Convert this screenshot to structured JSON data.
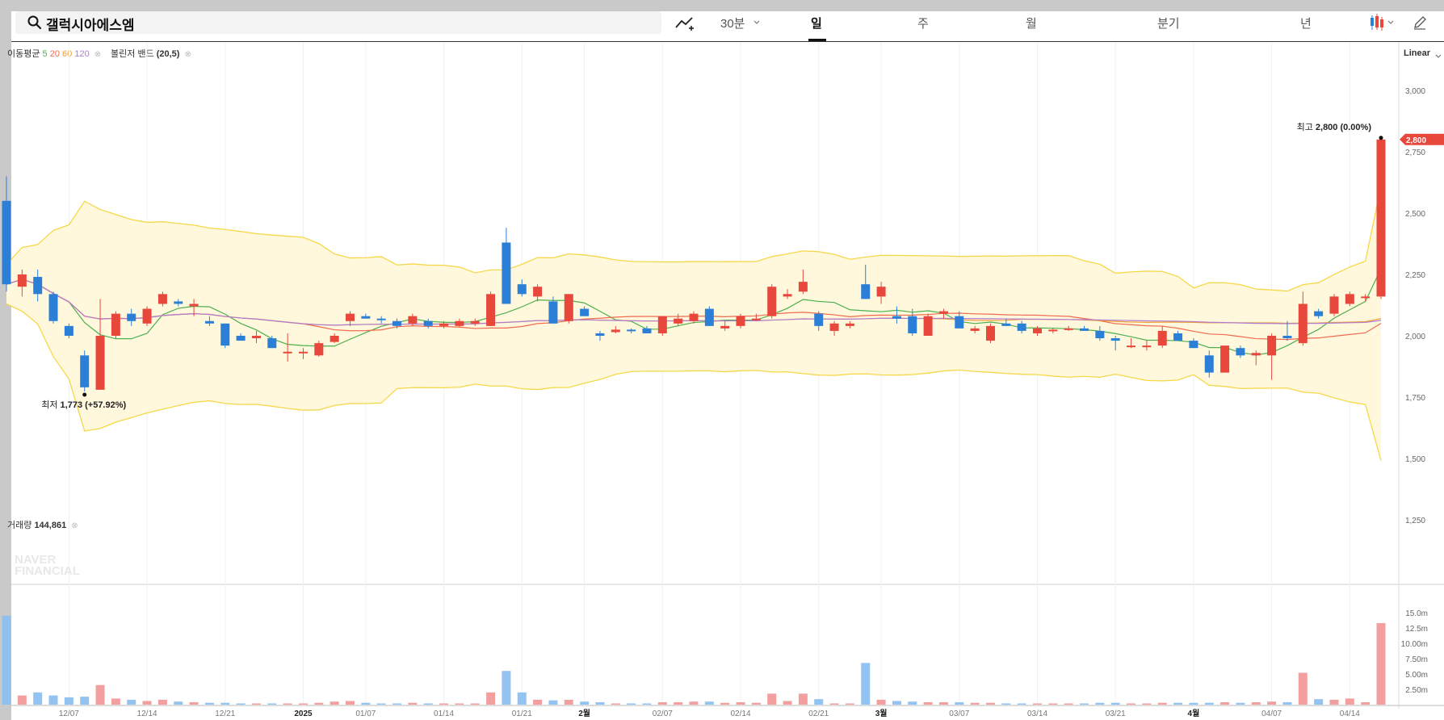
{
  "search": {
    "query": "갤럭시아에스엠"
  },
  "toolbar": {
    "interval": "30분",
    "periods": [
      "일",
      "주",
      "월",
      "분기",
      "년"
    ],
    "active_period": "일"
  },
  "indicators": {
    "ma_label": "이동평균",
    "ma_periods": [
      "5",
      "20",
      "60",
      "120"
    ],
    "ma_colors": [
      "#4caf50",
      "#f06b4f",
      "#f0a030",
      "#b07cd6"
    ],
    "bb_label": "볼린저 밴드",
    "bb_params": "(20,5)"
  },
  "scale_mode": "Linear",
  "volume_label": "거래량",
  "volume_value": "144,861",
  "watermark": [
    "NAVER",
    "FINANCIAL"
  ],
  "colors": {
    "up": "#e8473c",
    "down": "#2b7fd6",
    "band_line": "#f5d84a",
    "band_fill": "#fff8dc"
  },
  "chart_data": {
    "type": "candlestick",
    "price_ticks": [
      "3,000",
      "2,750",
      "2,500",
      "2,250",
      "2,000",
      "1,750",
      "1,500",
      "1,250"
    ],
    "price_tick_values": [
      3000,
      2750,
      2500,
      2250,
      2000,
      1750,
      1500,
      1250
    ],
    "volume_ticks": [
      "15.0m",
      "12.5m",
      "10.00m",
      "7.50m",
      "5.00m",
      "2.50m"
    ],
    "volume_tick_values": [
      15,
      12.5,
      10,
      7.5,
      5,
      2.5
    ],
    "x_ticks": [
      "12/07",
      "12/14",
      "12/21",
      "2025",
      "01/07",
      "01/14",
      "01/21",
      "2월",
      "02/07",
      "02/14",
      "02/21",
      "3월",
      "03/07",
      "03/14",
      "03/21",
      "4월",
      "04/07",
      "04/14"
    ],
    "x_tick_bold": [
      false,
      false,
      false,
      true,
      false,
      false,
      false,
      true,
      false,
      false,
      false,
      true,
      false,
      false,
      false,
      true,
      false,
      false
    ],
    "last_price_label": "2,800",
    "high": {
      "label": "최고",
      "value": "2,800",
      "change": "(0.00%)",
      "price": 2800
    },
    "low": {
      "label": "최저",
      "value": "1,773",
      "change": "(+57.92%)",
      "price": 1773
    },
    "candles": [
      {
        "o": 2550,
        "h": 2650,
        "l": 2180,
        "c": 2210,
        "v": 14.5
      },
      {
        "o": 2200,
        "h": 2270,
        "l": 2160,
        "c": 2250,
        "v": 1.5
      },
      {
        "o": 2240,
        "h": 2270,
        "l": 2140,
        "c": 2170,
        "v": 2.0
      },
      {
        "o": 2170,
        "h": 2180,
        "l": 2050,
        "c": 2060,
        "v": 1.5
      },
      {
        "o": 2040,
        "h": 2050,
        "l": 1990,
        "c": 2000,
        "v": 1.2
      },
      {
        "o": 1920,
        "h": 1940,
        "l": 1773,
        "c": 1790,
        "v": 1.3
      },
      {
        "o": 1780,
        "h": 2150,
        "l": 1780,
        "c": 2000,
        "v": 3.2
      },
      {
        "o": 2000,
        "h": 2100,
        "l": 1990,
        "c": 2090,
        "v": 1.0
      },
      {
        "o": 2090,
        "h": 2110,
        "l": 2040,
        "c": 2060,
        "v": 0.8
      },
      {
        "o": 2050,
        "h": 2120,
        "l": 2040,
        "c": 2110,
        "v": 0.6
      },
      {
        "o": 2130,
        "h": 2180,
        "l": 2120,
        "c": 2170,
        "v": 0.8
      },
      {
        "o": 2140,
        "h": 2150,
        "l": 2120,
        "c": 2130,
        "v": 0.5
      },
      {
        "o": 2120,
        "h": 2150,
        "l": 2080,
        "c": 2130,
        "v": 0.4
      },
      {
        "o": 2060,
        "h": 2080,
        "l": 2040,
        "c": 2050,
        "v": 0.3
      },
      {
        "o": 2050,
        "h": 2050,
        "l": 1950,
        "c": 1960,
        "v": 0.3
      },
      {
        "o": 2000,
        "h": 2010,
        "l": 1990,
        "c": 1980,
        "v": 0.2
      },
      {
        "o": 1990,
        "h": 2020,
        "l": 1970,
        "c": 2000,
        "v": 0.2
      },
      {
        "o": 1990,
        "h": 2000,
        "l": 1950,
        "c": 1950,
        "v": 0.2
      },
      {
        "o": 1935,
        "h": 2010,
        "l": 1895,
        "c": 1935,
        "v": 0.2
      },
      {
        "o": 1930,
        "h": 1950,
        "l": 1905,
        "c": 1935,
        "v": 0.2
      },
      {
        "o": 1920,
        "h": 1980,
        "l": 1915,
        "c": 1970,
        "v": 0.3
      },
      {
        "o": 1975,
        "h": 2010,
        "l": 1970,
        "c": 2000,
        "v": 0.5
      },
      {
        "o": 2060,
        "h": 2100,
        "l": 2040,
        "c": 2090,
        "v": 0.6
      },
      {
        "o": 2080,
        "h": 2090,
        "l": 2070,
        "c": 2070,
        "v": 0.3
      },
      {
        "o": 2070,
        "h": 2080,
        "l": 2050,
        "c": 2065,
        "v": 0.2
      },
      {
        "o": 2060,
        "h": 2070,
        "l": 2030,
        "c": 2040,
        "v": 0.2
      },
      {
        "o": 2050,
        "h": 2090,
        "l": 2040,
        "c": 2080,
        "v": 0.3
      },
      {
        "o": 2060,
        "h": 2070,
        "l": 2030,
        "c": 2040,
        "v": 0.2
      },
      {
        "o": 2040,
        "h": 2060,
        "l": 2030,
        "c": 2050,
        "v": 0.2
      },
      {
        "o": 2040,
        "h": 2070,
        "l": 2035,
        "c": 2060,
        "v": 0.2
      },
      {
        "o": 2050,
        "h": 2070,
        "l": 2040,
        "c": 2060,
        "v": 0.2
      },
      {
        "o": 2040,
        "h": 2180,
        "l": 2040,
        "c": 2170,
        "v": 2.0
      },
      {
        "o": 2380,
        "h": 2440,
        "l": 2130,
        "c": 2130,
        "v": 5.5
      },
      {
        "o": 2210,
        "h": 2230,
        "l": 2160,
        "c": 2170,
        "v": 2.0
      },
      {
        "o": 2160,
        "h": 2210,
        "l": 2140,
        "c": 2200,
        "v": 0.8
      },
      {
        "o": 2140,
        "h": 2160,
        "l": 2050,
        "c": 2050,
        "v": 0.7
      },
      {
        "o": 2060,
        "h": 2170,
        "l": 2050,
        "c": 2170,
        "v": 0.8
      },
      {
        "o": 2110,
        "h": 2120,
        "l": 2080,
        "c": 2080,
        "v": 0.5
      },
      {
        "o": 2010,
        "h": 2020,
        "l": 1980,
        "c": 2000,
        "v": 0.4
      },
      {
        "o": 2015,
        "h": 2040,
        "l": 2010,
        "c": 2025,
        "v": 0.2
      },
      {
        "o": 2025,
        "h": 2030,
        "l": 2010,
        "c": 2020,
        "v": 0.2
      },
      {
        "o": 2030,
        "h": 2040,
        "l": 2010,
        "c": 2010,
        "v": 0.2
      },
      {
        "o": 2010,
        "h": 2080,
        "l": 2000,
        "c": 2080,
        "v": 0.4
      },
      {
        "o": 2050,
        "h": 2090,
        "l": 2040,
        "c": 2070,
        "v": 0.4
      },
      {
        "o": 2060,
        "h": 2100,
        "l": 2050,
        "c": 2090,
        "v": 0.5
      },
      {
        "o": 2110,
        "h": 2120,
        "l": 2040,
        "c": 2040,
        "v": 0.5
      },
      {
        "o": 2030,
        "h": 2060,
        "l": 2020,
        "c": 2040,
        "v": 0.3
      },
      {
        "o": 2040,
        "h": 2090,
        "l": 2030,
        "c": 2080,
        "v": 0.4
      },
      {
        "o": 2070,
        "h": 2090,
        "l": 2060,
        "c": 2070,
        "v": 0.3
      },
      {
        "o": 2080,
        "h": 2210,
        "l": 2070,
        "c": 2200,
        "v": 1.8
      },
      {
        "o": 2160,
        "h": 2190,
        "l": 2150,
        "c": 2170,
        "v": 0.6
      },
      {
        "o": 2180,
        "h": 2270,
        "l": 2170,
        "c": 2220,
        "v": 1.8
      },
      {
        "o": 2090,
        "h": 2100,
        "l": 2020,
        "c": 2040,
        "v": 0.9
      },
      {
        "o": 2020,
        "h": 2060,
        "l": 2000,
        "c": 2050,
        "v": 0.2
      },
      {
        "o": 2040,
        "h": 2060,
        "l": 2030,
        "c": 2050,
        "v": 0.2
      },
      {
        "o": 2210,
        "h": 2290,
        "l": 2150,
        "c": 2150,
        "v": 6.8
      },
      {
        "o": 2160,
        "h": 2220,
        "l": 2130,
        "c": 2200,
        "v": 0.8
      },
      {
        "o": 2080,
        "h": 2120,
        "l": 2050,
        "c": 2070,
        "v": 0.6
      },
      {
        "o": 2080,
        "h": 2110,
        "l": 2000,
        "c": 2010,
        "v": 0.5
      },
      {
        "o": 2000,
        "h": 2090,
        "l": 2000,
        "c": 2080,
        "v": 0.4
      },
      {
        "o": 2090,
        "h": 2110,
        "l": 2070,
        "c": 2100,
        "v": 0.4
      },
      {
        "o": 2080,
        "h": 2100,
        "l": 2030,
        "c": 2030,
        "v": 0.4
      },
      {
        "o": 2020,
        "h": 2040,
        "l": 2010,
        "c": 2030,
        "v": 0.3
      },
      {
        "o": 1980,
        "h": 2050,
        "l": 1970,
        "c": 2040,
        "v": 0.3
      },
      {
        "o": 2050,
        "h": 2070,
        "l": 2040,
        "c": 2040,
        "v": 0.2
      },
      {
        "o": 2050,
        "h": 2060,
        "l": 2010,
        "c": 2020,
        "v": 0.2
      },
      {
        "o": 2010,
        "h": 2040,
        "l": 2000,
        "c": 2030,
        "v": 0.2
      },
      {
        "o": 2020,
        "h": 2030,
        "l": 2010,
        "c": 2025,
        "v": 0.2
      },
      {
        "o": 2030,
        "h": 2040,
        "l": 2020,
        "c": 2030,
        "v": 0.2
      },
      {
        "o": 2030,
        "h": 2040,
        "l": 2020,
        "c": 2020,
        "v": 0.2
      },
      {
        "o": 2020,
        "h": 2040,
        "l": 1980,
        "c": 1990,
        "v": 0.3
      },
      {
        "o": 1990,
        "h": 2000,
        "l": 1940,
        "c": 1980,
        "v": 0.3
      },
      {
        "o": 1960,
        "h": 1990,
        "l": 1950,
        "c": 1960,
        "v": 0.2
      },
      {
        "o": 1960,
        "h": 1980,
        "l": 1940,
        "c": 1960,
        "v": 0.2
      },
      {
        "o": 1960,
        "h": 2040,
        "l": 1950,
        "c": 2020,
        "v": 0.3
      },
      {
        "o": 2010,
        "h": 2020,
        "l": 1980,
        "c": 1980,
        "v": 0.3
      },
      {
        "o": 1980,
        "h": 1990,
        "l": 1950,
        "c": 1950,
        "v": 0.3
      },
      {
        "o": 1920,
        "h": 1940,
        "l": 1830,
        "c": 1850,
        "v": 0.3
      },
      {
        "o": 1850,
        "h": 1960,
        "l": 1850,
        "c": 1960,
        "v": 0.4
      },
      {
        "o": 1950,
        "h": 1960,
        "l": 1910,
        "c": 1920,
        "v": 0.3
      },
      {
        "o": 1920,
        "h": 1940,
        "l": 1880,
        "c": 1930,
        "v": 0.4
      },
      {
        "o": 1920,
        "h": 2010,
        "l": 1820,
        "c": 2000,
        "v": 0.5
      },
      {
        "o": 2000,
        "h": 2060,
        "l": 1980,
        "c": 1990,
        "v": 0.4
      },
      {
        "o": 1970,
        "h": 2180,
        "l": 1960,
        "c": 2130,
        "v": 5.2
      },
      {
        "o": 2100,
        "h": 2110,
        "l": 2070,
        "c": 2080,
        "v": 0.9
      },
      {
        "o": 2090,
        "h": 2170,
        "l": 2080,
        "c": 2160,
        "v": 0.8
      },
      {
        "o": 2130,
        "h": 2180,
        "l": 2120,
        "c": 2170,
        "v": 1.0
      },
      {
        "o": 2160,
        "h": 2170,
        "l": 2140,
        "c": 2160,
        "v": 0.4
      },
      {
        "o": 2160,
        "h": 2800,
        "l": 2150,
        "c": 2800,
        "v": 13.3
      }
    ]
  }
}
